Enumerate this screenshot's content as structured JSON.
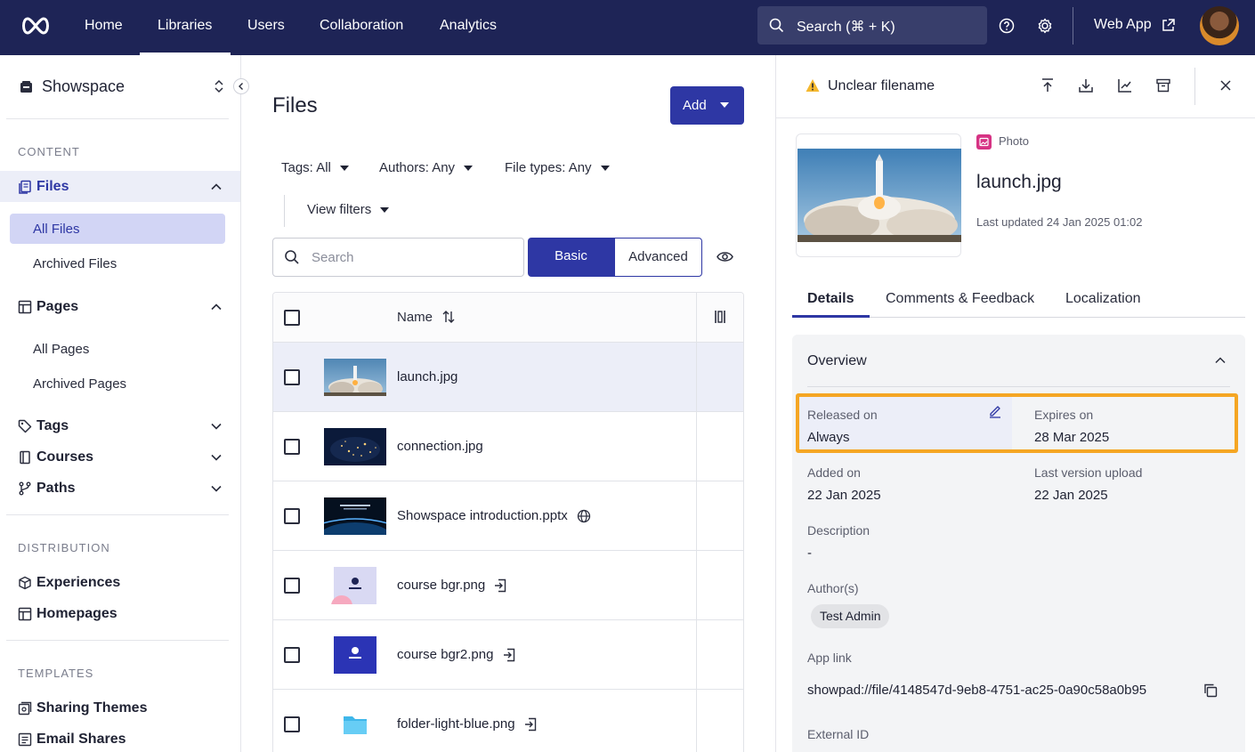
{
  "nav": {
    "items": [
      "Home",
      "Libraries",
      "Users",
      "Collaboration",
      "Analytics"
    ],
    "search_label": "Search (⌘ + K)",
    "web_app_label": "Web App"
  },
  "sidebar": {
    "workspace": "Showspace",
    "content_label": "CONTENT",
    "files_label": "Files",
    "all_files": "All Files",
    "archived_files": "Archived Files",
    "pages_label": "Pages",
    "all_pages": "All Pages",
    "archived_pages": "Archived Pages",
    "tags": "Tags",
    "courses": "Courses",
    "paths": "Paths",
    "distribution_label": "DISTRIBUTION",
    "experiences": "Experiences",
    "homepages": "Homepages",
    "templates_label": "TEMPLATES",
    "sharing_themes": "Sharing Themes",
    "email_shares": "Email Shares"
  },
  "main": {
    "title": "Files",
    "add_label": "Add",
    "filters": {
      "tags": "Tags: All",
      "authors": "Authors: Any",
      "file_types": "File types: Any",
      "view_filters": "View filters"
    },
    "search_placeholder": "Search",
    "mode_basic": "Basic",
    "mode_advanced": "Advanced",
    "table": {
      "name_header": "Name",
      "rows": [
        {
          "name": "launch.jpg",
          "selected": true
        },
        {
          "name": "connection.jpg"
        },
        {
          "name": "Showspace introduction.pptx",
          "suffix_icon": "globe-icon"
        },
        {
          "name": "course bgr.png",
          "suffix_icon": "import-icon"
        },
        {
          "name": "course bgr2.png",
          "suffix_icon": "import-icon"
        },
        {
          "name": "folder-light-blue.png",
          "suffix_icon": "import-icon"
        }
      ]
    }
  },
  "panel": {
    "warning": "Unclear filename",
    "file_type": "Photo",
    "file_name": "launch.jpg",
    "last_updated": "Last updated 24 Jan 2025 01:02",
    "tabs": [
      "Details",
      "Comments & Feedback",
      "Localization"
    ],
    "overview_title": "Overview",
    "released_label": "Released on",
    "released_value": "Always",
    "expires_label": "Expires on",
    "expires_value": "28 Mar 2025",
    "added_label": "Added on",
    "added_value": "22 Jan 2025",
    "last_version_label": "Last version upload",
    "last_version_value": "22 Jan 2025",
    "description_label": "Description",
    "description_value": "-",
    "authors_label": "Author(s)",
    "author": "Test Admin",
    "app_link_label": "App link",
    "app_link_value": "showpad://file/4148547d-9eb8-4751-ac25-0a90c58a0b95",
    "external_id_label": "External ID"
  },
  "colors": {
    "nav_bg": "#1e2456",
    "accent": "#2e37a4",
    "highlight": "#f5a623",
    "photo_badge": "#d63384"
  }
}
